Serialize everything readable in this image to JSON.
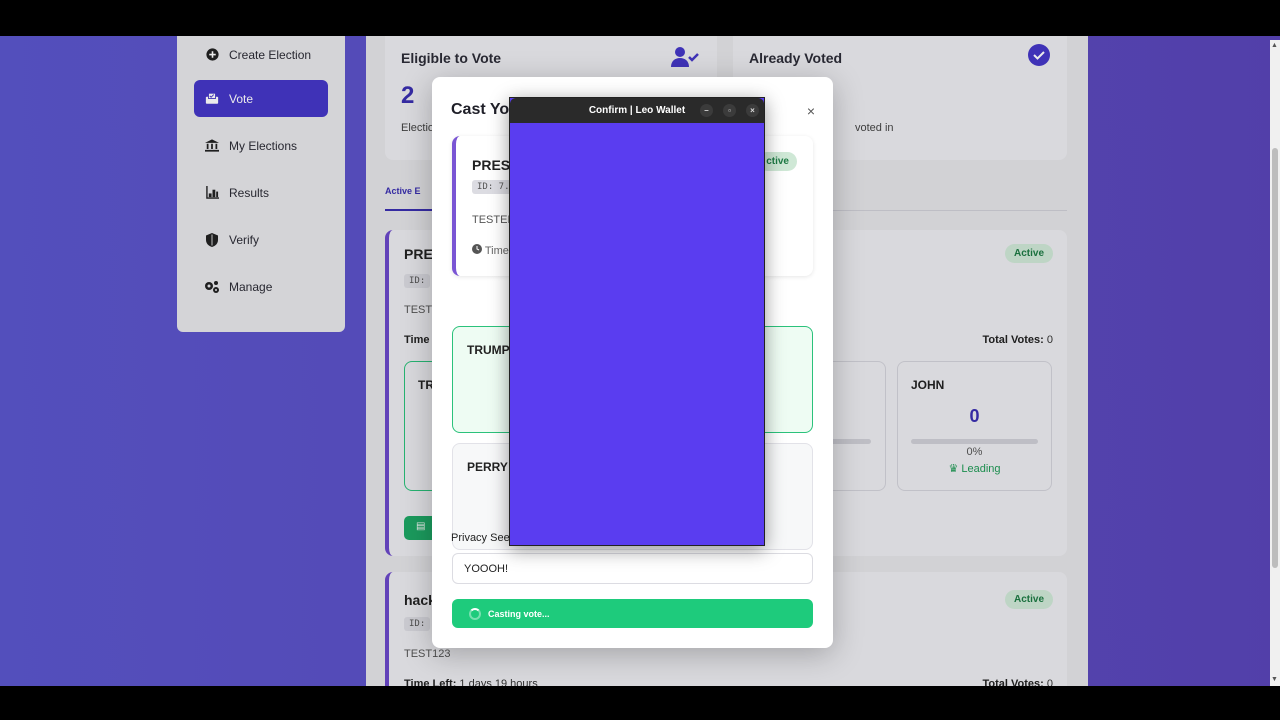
{
  "sidebar": {
    "items": [
      {
        "label": "Create Election",
        "icon": "plus-circle-icon"
      },
      {
        "label": "Vote",
        "icon": "ballot-icon",
        "active": true
      },
      {
        "label": "My Elections",
        "icon": "bank-icon"
      },
      {
        "label": "Results",
        "icon": "bar-chart-icon"
      },
      {
        "label": "Verify",
        "icon": "shield-icon"
      },
      {
        "label": "Manage",
        "icon": "gears-icon"
      }
    ]
  },
  "stats": {
    "eligible": {
      "title": "Eligible to Vote",
      "value": "2",
      "sub": "Electio"
    },
    "voted": {
      "title": "Already Voted",
      "sub": "voted in"
    }
  },
  "tabs": {
    "active": "Active E"
  },
  "elections": [
    {
      "title": "PRE",
      "id_label": "ID:",
      "desc": "TEST",
      "time_label": "Time",
      "badge": "Active",
      "total_label": "Total Votes:",
      "total": "0",
      "candidates": [
        {
          "name": "TR"
        },
        {
          "name": "JOHN",
          "votes": "0",
          "pct": "0%",
          "lead": "Leading"
        }
      ]
    },
    {
      "title": "hack",
      "id_label": "ID:",
      "desc": "TEST123",
      "time_label": "Time Left:",
      "time_value": "1 days 19 hours",
      "badge": "Active",
      "total_label": "Total Votes:",
      "total": "0"
    }
  ],
  "modal": {
    "title": "Cast Yo",
    "close": "×",
    "election": {
      "title": "PRESI",
      "id": "ID: 7.",
      "desc": "TESTED",
      "time": "Time",
      "badge": "ctive"
    },
    "candidates": [
      {
        "name": "TRUMP",
        "selected": true
      },
      {
        "name": "PERRY"
      }
    ],
    "privacy_label": "Privacy See",
    "privacy_value": "YOOOH!",
    "cast_label": "Casting vote..."
  },
  "wallet": {
    "title": "Confirm | Leo Wallet",
    "color": "#5a3df0"
  },
  "colors": {
    "accent": "#4537c7",
    "success": "#1ecb7c"
  }
}
